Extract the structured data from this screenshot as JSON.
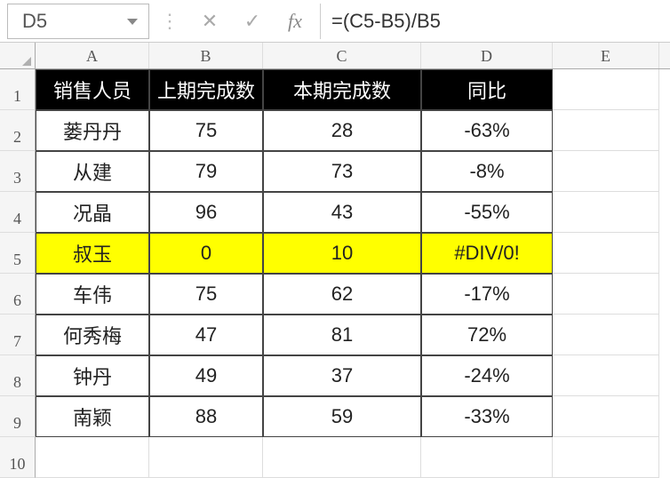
{
  "formula_bar": {
    "cell_ref": "D5",
    "formula": "=(C5-B5)/B5",
    "fx_label": "fx"
  },
  "columns": [
    "A",
    "B",
    "C",
    "D",
    "E"
  ],
  "row_numbers": [
    "1",
    "2",
    "3",
    "4",
    "5",
    "6",
    "7",
    "8",
    "9",
    "10"
  ],
  "headers": {
    "A": "销售人员",
    "B": "上期完成数",
    "C": "本期完成数",
    "D": "同比"
  },
  "rows": [
    {
      "A": "蒌丹丹",
      "B": "75",
      "C": "28",
      "D": "-63%"
    },
    {
      "A": "从建",
      "B": "79",
      "C": "73",
      "D": "-8%"
    },
    {
      "A": "况晶",
      "B": "96",
      "C": "43",
      "D": "-55%"
    },
    {
      "A": "叔玉",
      "B": "0",
      "C": "10",
      "D": "#DIV/0!"
    },
    {
      "A": "车伟",
      "B": "75",
      "C": "62",
      "D": "-17%"
    },
    {
      "A": "何秀梅",
      "B": "47",
      "C": "81",
      "D": "72%"
    },
    {
      "A": "钟丹",
      "B": "49",
      "C": "37",
      "D": "-24%"
    },
    {
      "A": "南颖",
      "B": "88",
      "C": "59",
      "D": "-33%"
    }
  ],
  "highlight_row_index": 3
}
